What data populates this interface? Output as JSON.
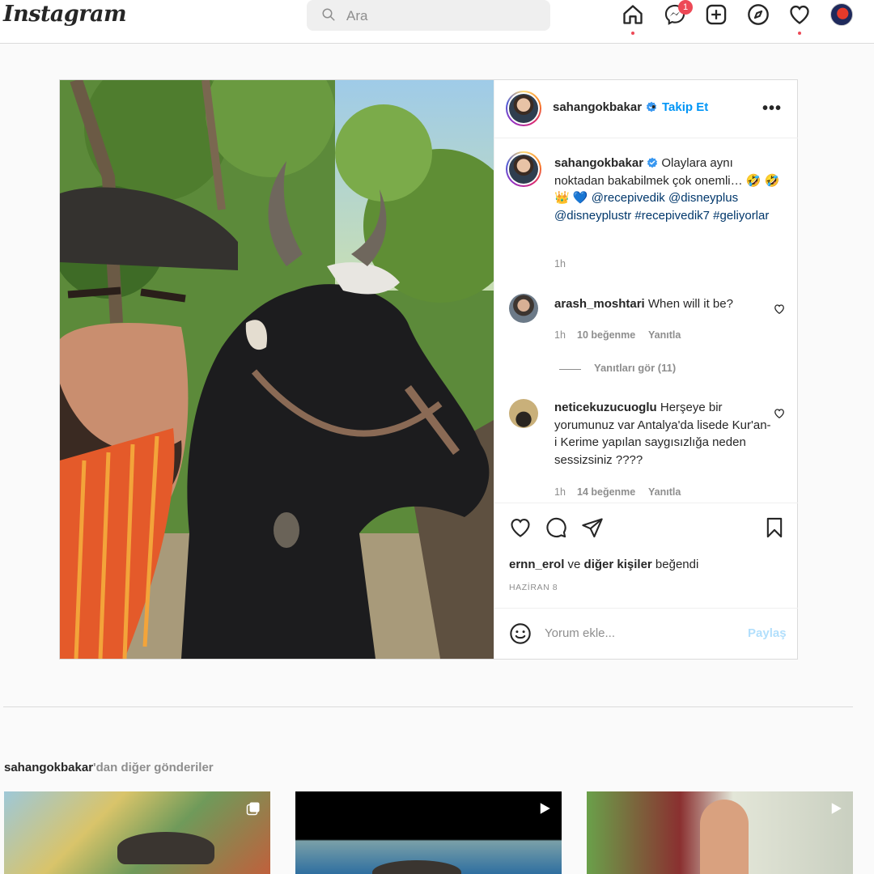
{
  "app": {
    "logo": "Instagram",
    "search_placeholder": "Ara",
    "messenger_badge": "1"
  },
  "post": {
    "author": "sahangokbakar",
    "follow_label": "Takip Et",
    "dot": "•",
    "more_label": "•••",
    "caption": {
      "username": "sahangokbakar",
      "text": "Olaylara aynı noktadan bakabilmek çok onemli… 🤣 🤣 👑 💙 ",
      "mentions": "@recepivedik @disneyplus @disneyplustr #recepivedik7 #geliyorlar",
      "time": "1h"
    },
    "comments": [
      {
        "username": "arash_moshtari",
        "text": "When will it be?",
        "time": "1h",
        "likes": "10 beğenme",
        "reply": "Yanıtla",
        "view_replies": "Yanıtları gör (11)"
      },
      {
        "username": "neticekuzucuoglu",
        "text": "Herşeye bir yorumunuz var Antalya'da lisede Kur'an-i Kerime yapılan saygısızlığa neden sessizsiniz ????",
        "time": "1h",
        "likes": "14 beğenme",
        "reply": "Yanıtla"
      }
    ],
    "liked_by": {
      "user": "ernn_erol",
      "connector": " ve ",
      "others": "diğer kişiler",
      "suffix": " beğendi"
    },
    "date": "HAZİRAN 8",
    "comment_placeholder": "Yorum ekle...",
    "share_label": "Paylaş"
  },
  "more_posts": {
    "username": "sahangokbakar",
    "suffix": "'dan diğer gönderiler"
  },
  "colors": {
    "accent": "#0095f6",
    "notification": "#ed4956",
    "link": "#00376b"
  }
}
